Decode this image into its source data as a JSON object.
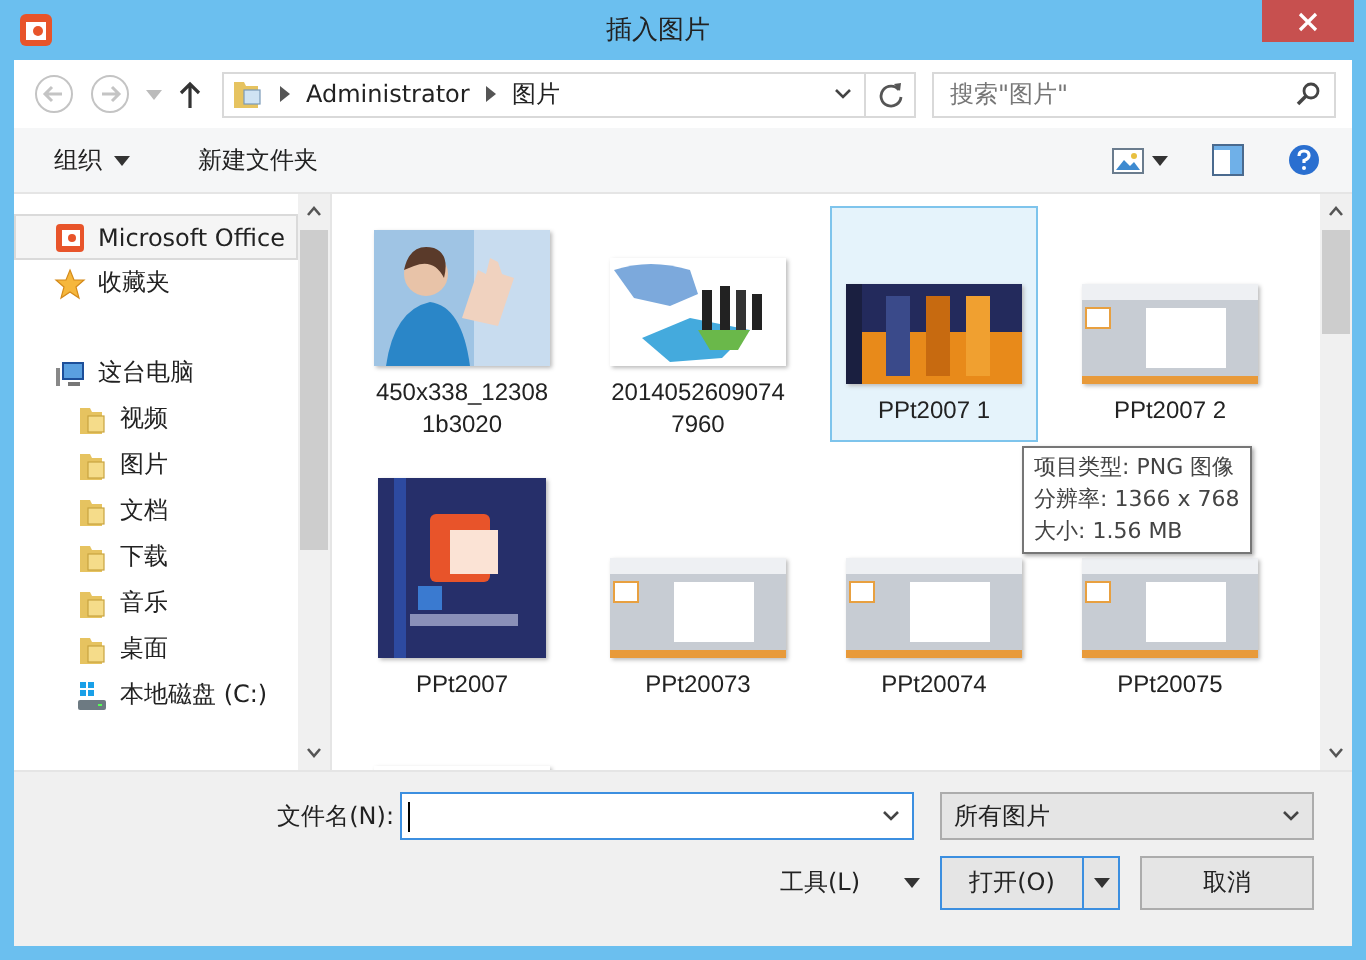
{
  "window": {
    "title": "插入图片"
  },
  "address": {
    "crumbs": [
      "Administrator",
      "图片"
    ]
  },
  "search": {
    "placeholder": "搜索\"图片\""
  },
  "toolbar": {
    "buttons": [
      "组织",
      "新建文件夹"
    ]
  },
  "sidebar": {
    "items": [
      {
        "label": "Microsoft Office",
        "kind": "office",
        "selected": true
      },
      {
        "label": "收藏夹",
        "kind": "favorites",
        "selected": false
      },
      {
        "label": "这台电脑",
        "kind": "computer",
        "selected": false,
        "children": [
          {
            "label": "视频",
            "kind": "folder",
            "selected": false
          },
          {
            "label": "图片",
            "kind": "folder",
            "selected": false
          },
          {
            "label": "文档",
            "kind": "folder",
            "selected": false
          },
          {
            "label": "下载",
            "kind": "folder",
            "selected": false
          },
          {
            "label": "音乐",
            "kind": "folder",
            "selected": false
          },
          {
            "label": "桌面",
            "kind": "folder",
            "selected": false
          },
          {
            "label": "本地磁盘 (C:)",
            "kind": "drive",
            "selected": false
          }
        ]
      }
    ]
  },
  "files": [
    {
      "name": "450x338_123081b3020",
      "selected": false
    },
    {
      "name": "20140526090747960",
      "selected": false
    },
    {
      "name": "PPt2007 1",
      "selected": true
    },
    {
      "name": "PPt2007 2",
      "selected": false
    },
    {
      "name": "PPt2007",
      "selected": false
    },
    {
      "name": "PPt20073",
      "selected": false
    },
    {
      "name": "PPt20074",
      "selected": false
    },
    {
      "name": "PPt20075",
      "selected": false
    }
  ],
  "tooltip": {
    "lines": [
      "项目类型: PNG 图像",
      "分辨率: 1366 x 768",
      "大小: 1.56 MB"
    ]
  },
  "filename": {
    "label": "文件名(N):"
  },
  "filetype": {
    "value": "所有图片"
  },
  "buttons": {
    "tools": "工具(L)",
    "open": "打开(O)",
    "cancel": "取消"
  }
}
